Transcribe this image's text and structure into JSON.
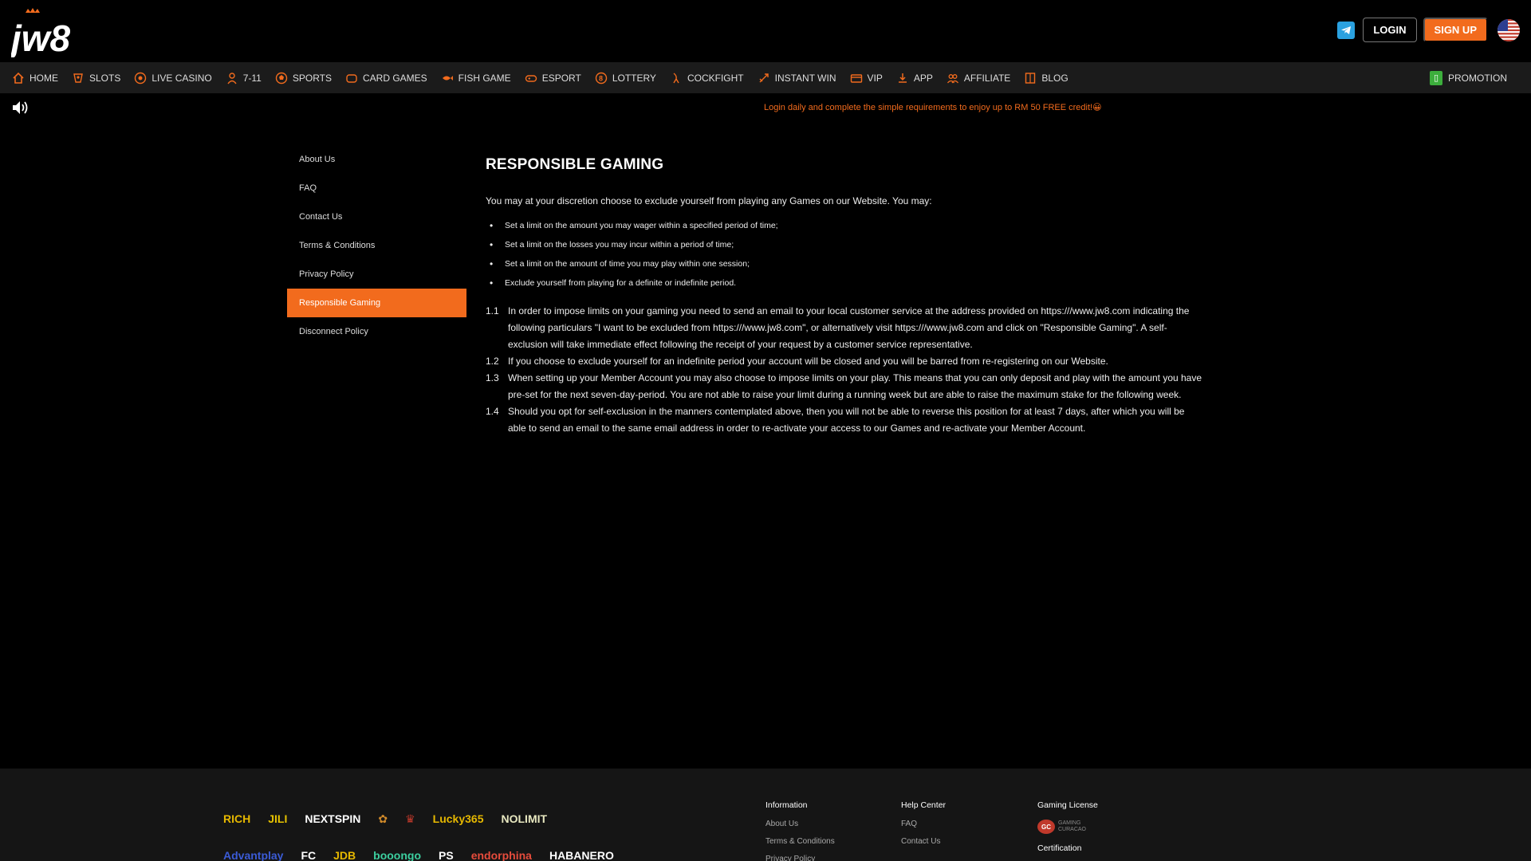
{
  "header": {
    "logo_text": "jw8",
    "login_label": "LOGIN",
    "signup_label": "SIGN UP",
    "telegram_icon": "telegram-icon",
    "flag_icon": "us-flag-icon"
  },
  "nav": {
    "items": [
      {
        "label": "HOME",
        "icon": "home-icon"
      },
      {
        "label": "SLOTS",
        "icon": "slots-icon"
      },
      {
        "label": "LIVE CASINO",
        "icon": "live-casino-icon"
      },
      {
        "label": "7-11",
        "icon": "seven-eleven-icon"
      },
      {
        "label": "SPORTS",
        "icon": "sports-icon"
      },
      {
        "label": "CARD GAMES",
        "icon": "card-games-icon"
      },
      {
        "label": "FISH GAME",
        "icon": "fish-game-icon"
      },
      {
        "label": "ESPORT",
        "icon": "esport-icon"
      },
      {
        "label": "LOTTERY",
        "icon": "lottery-icon"
      },
      {
        "label": "COCKFIGHT",
        "icon": "cockfight-icon"
      },
      {
        "label": "INSTANT WIN",
        "icon": "instant-win-icon"
      },
      {
        "label": "VIP",
        "icon": "vip-icon"
      },
      {
        "label": "APP",
        "icon": "app-icon"
      },
      {
        "label": "AFFILIATE",
        "icon": "affiliate-icon"
      },
      {
        "label": "BLOG",
        "icon": "blog-icon"
      }
    ],
    "promotion_label": "PROMOTION"
  },
  "marquee": {
    "text": "Login daily and complete the simple requirements to enjoy up to RM 50 FREE credit!😀"
  },
  "sidebar": {
    "items": [
      {
        "label": "About Us",
        "active": false
      },
      {
        "label": "FAQ",
        "active": false
      },
      {
        "label": "Contact Us",
        "active": false
      },
      {
        "label": "Terms & Conditions",
        "active": false
      },
      {
        "label": "Privacy Policy",
        "active": false
      },
      {
        "label": "Responsible Gaming",
        "active": true
      },
      {
        "label": "Disconnect Policy",
        "active": false
      }
    ]
  },
  "content": {
    "title": "RESPONSIBLE GAMING",
    "intro": "You may at your discretion choose to exclude yourself from playing any Games on our Website. You may:",
    "bullets": [
      "Set a limit on the amount you may wager within a specified period of time;",
      "Set a limit on the losses you may incur within a period of time;",
      "Set a limit on the amount of time you may play within one session;",
      "Exclude yourself from playing for a definite or indefinite period."
    ],
    "clauses": [
      {
        "num": "1.1",
        "text": "In order to impose limits on your gaming you need to send an email to your local customer service at the address provided on https:///www.jw8.com indicating the following particulars \"I want to be excluded from https:///www.jw8.com\", or alternatively visit https:///www.jw8.com and click on \"Responsible Gaming\". A self-exclusion will take immediate effect following the receipt of your request by a customer service representative."
      },
      {
        "num": "1.2",
        "text": "If you choose to exclude yourself for an indefinite period your account will be closed and you will be barred from re-registering on our Website."
      },
      {
        "num": "1.3",
        "text": "When setting up your Member Account you may also choose to impose limits on your play. This means that you can only deposit and play with the amount you have pre-set for the next seven-day-period. You are not able to raise your limit during a running week but are able to raise the maximum stake for the following week."
      },
      {
        "num": "1.4",
        "text": "Should you opt for self-exclusion in the manners contemplated above, then you will not be able to reverse this position for at least 7 days, after which you will be able to send an email to the same email address in order to re-activate your access to our Games and re-activate your Member Account."
      }
    ]
  },
  "footer": {
    "providers_row1": [
      {
        "name": "RICH",
        "color": "#e6b800"
      },
      {
        "name": "JILI",
        "color": "#e6c200"
      },
      {
        "name": "NEXTSPIN",
        "color": "#ffffff"
      },
      {
        "name": "✿",
        "color": "#d08a2a"
      },
      {
        "name": "♛",
        "color": "#c0392b"
      },
      {
        "name": "Lucky365",
        "color": "#e6b800"
      },
      {
        "name": "NOLIMIT",
        "color": "#e8e8c0"
      }
    ],
    "providers_row2": [
      {
        "name": "Advantplay",
        "color": "#3b5bd6"
      },
      {
        "name": "FC",
        "color": "#ffffff"
      },
      {
        "name": "JDB",
        "color": "#e6b800"
      },
      {
        "name": "booongo",
        "color": "#3ccf9f"
      },
      {
        "name": "PS",
        "color": "#ffffff"
      },
      {
        "name": "endorphina",
        "color": "#e74c3c"
      },
      {
        "name": "HABANERO",
        "color": "#ffffff"
      }
    ],
    "information": {
      "heading": "Information",
      "links": [
        "About Us",
        "Terms & Conditions",
        "Privacy Policy"
      ]
    },
    "help_center": {
      "heading": "Help Center",
      "links": [
        "FAQ",
        "Contact Us"
      ]
    },
    "gaming_license": {
      "heading": "Gaming License",
      "badge_text": "GC",
      "badge_caption": "GAMING CURACAO"
    },
    "certification": {
      "heading": "Certification"
    }
  }
}
